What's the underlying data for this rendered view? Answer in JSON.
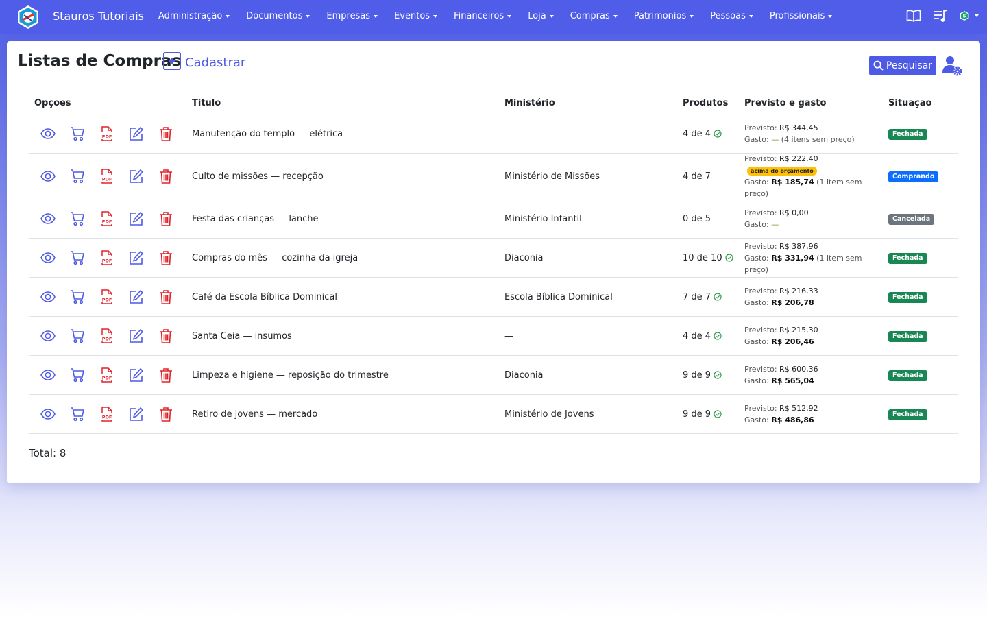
{
  "app": {
    "brand": "Stauros Tutoriais",
    "nav": [
      "Administração",
      "Documentos",
      "Empresas",
      "Eventos",
      "Financeiros",
      "Loja",
      "Compras",
      "Patrimonios",
      "Pessoas",
      "Profissionais"
    ]
  },
  "page": {
    "title": "Listas de Compras",
    "add_label": "Cadastrar",
    "search_label": "Pesquisar",
    "total_label": "Total: 8"
  },
  "table": {
    "headers": {
      "options": "Opções",
      "title": "Titulo",
      "ministry": "Ministério",
      "products": "Produtos",
      "budget": "Previsto e gasto",
      "status": "Situação"
    },
    "labels": {
      "previsto": "Previsto:",
      "gasto": "Gasto:",
      "over_budget": "acima do orçamento"
    },
    "rows": [
      {
        "title": "Manutenção do templo — elétrica",
        "ministry": "—",
        "products": "4 de 4",
        "complete": true,
        "previsto": "R$ 344,45",
        "gasto": "—",
        "gasto_bold": false,
        "note": "(4 itens sem preço)",
        "over_budget": false,
        "status": "Fechada",
        "status_color": "#198754"
      },
      {
        "title": "Culto de missões — recepção",
        "ministry": "Ministério de Missões",
        "products": "4 de 7",
        "complete": false,
        "previsto": "R$ 222,40",
        "gasto": "R$ 185,74",
        "gasto_bold": true,
        "note": "(1 item sem preço)",
        "over_budget": true,
        "status": "Comprando",
        "status_color": "#0d6efd"
      },
      {
        "title": "Festa das crianças — lanche",
        "ministry": "Ministério Infantil",
        "products": "0 de 5",
        "complete": false,
        "previsto": "R$ 0,00",
        "gasto": "—",
        "gasto_bold": false,
        "note": "",
        "over_budget": false,
        "status": "Cancelada",
        "status_color": "#6c757d"
      },
      {
        "title": "Compras do mês — cozinha da igreja",
        "ministry": "Diaconia",
        "products": "10 de 10",
        "complete": true,
        "previsto": "R$ 387,96",
        "gasto": "R$ 331,94",
        "gasto_bold": true,
        "note": "(1 item sem preço)",
        "over_budget": false,
        "status": "Fechada",
        "status_color": "#198754"
      },
      {
        "title": "Café da Escola Bíblica Dominical",
        "ministry": "Escola Bíblica Dominical",
        "products": "7 de 7",
        "complete": true,
        "previsto": "R$ 216,33",
        "gasto": "R$ 206,78",
        "gasto_bold": true,
        "note": "",
        "over_budget": false,
        "status": "Fechada",
        "status_color": "#198754"
      },
      {
        "title": "Santa Ceia — insumos",
        "ministry": "—",
        "products": "4 de 4",
        "complete": true,
        "previsto": "R$ 215,30",
        "gasto": "R$ 206,46",
        "gasto_bold": true,
        "note": "",
        "over_budget": false,
        "status": "Fechada",
        "status_color": "#198754"
      },
      {
        "title": "Limpeza e higiene — reposição do trimestre",
        "ministry": "Diaconia",
        "products": "9 de 9",
        "complete": true,
        "previsto": "R$ 600,36",
        "gasto": "R$ 565,04",
        "gasto_bold": true,
        "note": "",
        "over_budget": false,
        "status": "Fechada",
        "status_color": "#198754"
      },
      {
        "title": "Retiro de jovens — mercado",
        "ministry": "Ministério de Jovens",
        "products": "9 de 9",
        "complete": true,
        "previsto": "R$ 512,92",
        "gasto": "R$ 486,86",
        "gasto_bold": true,
        "note": "",
        "over_budget": false,
        "status": "Fechada",
        "status_color": "#198754"
      }
    ]
  }
}
